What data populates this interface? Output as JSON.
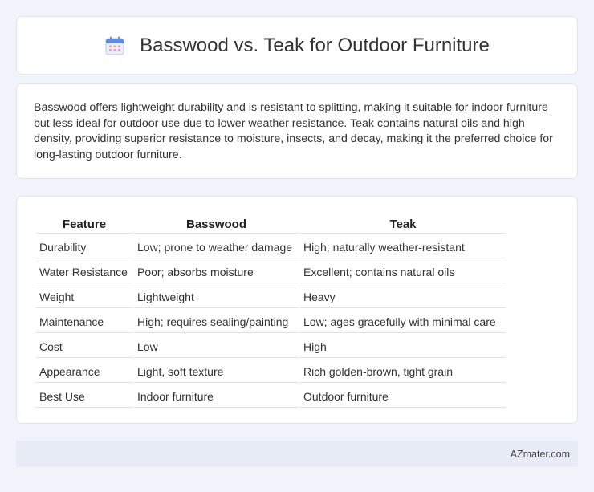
{
  "header": {
    "title": "Basswood vs. Teak for Outdoor Furniture",
    "icon": "calendar-icon"
  },
  "description": "Basswood offers lightweight durability and is resistant to splitting, making it suitable for indoor furniture but less ideal for outdoor use due to lower weather resistance. Teak contains natural oils and high density, providing superior resistance to moisture, insects, and decay, making it the preferred choice for long-lasting outdoor furniture.",
  "table": {
    "headers": [
      "Feature",
      "Basswood",
      "Teak"
    ],
    "rows": [
      [
        "Durability",
        "Low; prone to weather damage",
        "High; naturally weather-resistant"
      ],
      [
        "Water Resistance",
        "Poor; absorbs moisture",
        "Excellent; contains natural oils"
      ],
      [
        "Weight",
        "Lightweight",
        "Heavy"
      ],
      [
        "Maintenance",
        "High; requires sealing/painting",
        "Low; ages gracefully with minimal care"
      ],
      [
        "Cost",
        "Low",
        "High"
      ],
      [
        "Appearance",
        "Light, soft texture",
        "Rich golden-brown, tight grain"
      ],
      [
        "Best Use",
        "Indoor furniture",
        "Outdoor furniture"
      ]
    ]
  },
  "footer": {
    "brand": "AZmater.com"
  },
  "colors": {
    "background": "#f0f3f9",
    "card": "#ffffff",
    "footer": "#e6ebf5",
    "icon_blue": "#5b8def",
    "icon_pink": "#f29bb5"
  }
}
